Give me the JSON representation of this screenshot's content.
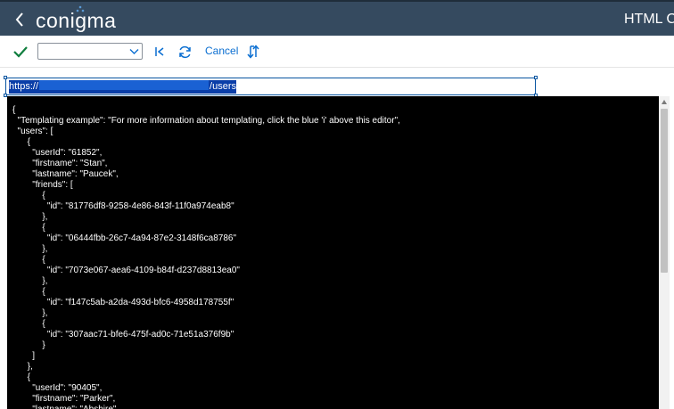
{
  "header": {
    "logo_text": "conigma",
    "app_title": "HTML C"
  },
  "toolbar": {
    "select_value": "",
    "cancel_label": "Cancel"
  },
  "url_field": {
    "prefix": "https://",
    "suffix": "/users"
  },
  "editor": {
    "code": "{\n  \"Templating example\": \"For more information about templating, click the blue 'i' above this editor\",\n  \"users\": [\n      {\n        \"userId\": \"61852\",\n        \"firstname\": \"Stan\",\n        \"lastname\": \"Paucek\",\n        \"friends\": [\n            {\n              \"id\": \"81776df8-9258-4e86-843f-11f0a974eab8\"\n            },\n            {\n              \"id\": \"06444fbb-26c7-4a94-87e2-3148f6ca8786\"\n            },\n            {\n              \"id\": \"7073e067-aea6-4109-b84f-d237d8813ea0\"\n            },\n            {\n              \"id\": \"f147c5ab-a2da-493d-bfc6-4958d178755f\"\n            },\n            {\n              \"id\": \"307aac71-bfe6-475f-ad0c-71e51a376f9b\"\n            }\n        ]\n      },\n      {\n        \"userId\": \"90405\",\n        \"firstname\": \"Parker\",\n        \"lastname\": \"Abshire\","
  },
  "icons": {
    "back": "chevron-left-icon",
    "confirm": "checkmark-icon",
    "first": "go-to-start-icon",
    "refresh": "refresh-icon",
    "cycle": "cycle-icon"
  },
  "colors": {
    "header_bg": "#354a5f",
    "accent": "#0a6ed1",
    "confirm": "#107e3e",
    "editor_bg": "#000000",
    "selection": "#0a3ea8"
  }
}
